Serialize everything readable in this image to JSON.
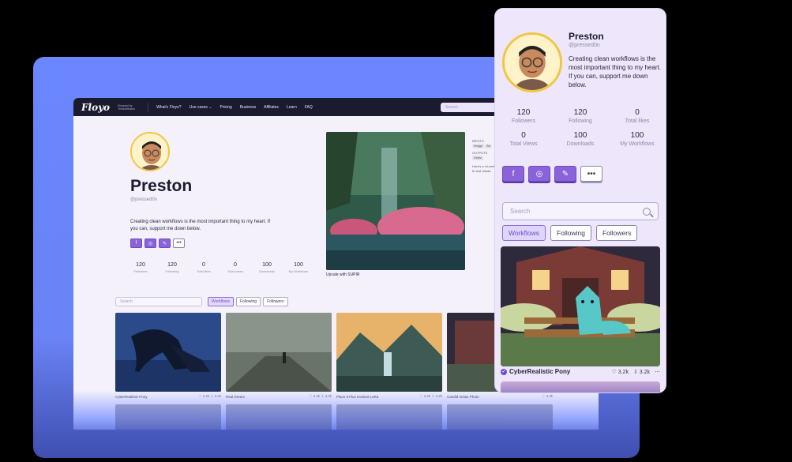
{
  "nav": {
    "logo": "Floyo",
    "logo_sub": "Powered by ThinkDiffusion",
    "items": [
      "What's Floyo?",
      "Use cases",
      "Pricing",
      "Business",
      "Affiliates",
      "Learn",
      "FAQ"
    ],
    "search_placeholder": "Search"
  },
  "profile": {
    "name": "Preston",
    "handle": "@pressed0n",
    "bio": "Creating clean workflows is the most important thing to my heart. If you can, support me down below.",
    "stats": [
      {
        "value": "120",
        "label": "Followers"
      },
      {
        "value": "120",
        "label": "Following"
      },
      {
        "value": "0",
        "label": "Total likes"
      },
      {
        "value": "0",
        "label": "Total views"
      },
      {
        "value": "100",
        "label": "Downloads"
      },
      {
        "value": "100",
        "label": "My Workflows"
      }
    ],
    "mobile_stats": [
      {
        "value": "120",
        "label": "Followers"
      },
      {
        "value": "120",
        "label": "Following"
      },
      {
        "value": "0",
        "label": "Total likes"
      },
      {
        "value": "0",
        "label": "Total Views"
      },
      {
        "value": "100",
        "label": "Downloads"
      },
      {
        "value": "100",
        "label": "My Workflows"
      }
    ],
    "socials": [
      "facebook-icon",
      "instagram-icon",
      "brush-icon",
      "more-icon"
    ],
    "more_label": "•••"
  },
  "featured": {
    "caption": "Upcale with SUPIR",
    "inputs_label": "INPUTS",
    "input_tags": [
      "Image",
      "An"
    ],
    "outputs_label": "OUTPUTS",
    "output_tags": [
      "Video"
    ],
    "desc": "Here's a cli workflow th and Vanda"
  },
  "filters": {
    "search_placeholder": "Search",
    "tabs": [
      "Workflows",
      "Following",
      "Followers"
    ],
    "active": "Workflows"
  },
  "cards": [
    {
      "title": "CyberRealistic Pony",
      "likes": "3.2k",
      "downloads": "3.2k"
    },
    {
      "title": "Real Dream",
      "likes": "3.2k",
      "downloads": "3.2k"
    },
    {
      "title": "Place It Flux Kontext LoRa",
      "likes": "3.2k",
      "downloads": "3.2k"
    },
    {
      "title": "Candid Instax Photo",
      "likes": "3.2k",
      "downloads": "3.2k"
    }
  ],
  "mobile_card": {
    "title": "CyberRealistic Pony",
    "likes": "3.2k",
    "downloads": "3.2k"
  },
  "colors": {
    "accent": "#8a63d8",
    "backdrop": "#6b86ff",
    "navbar": "#1b1a2e"
  }
}
